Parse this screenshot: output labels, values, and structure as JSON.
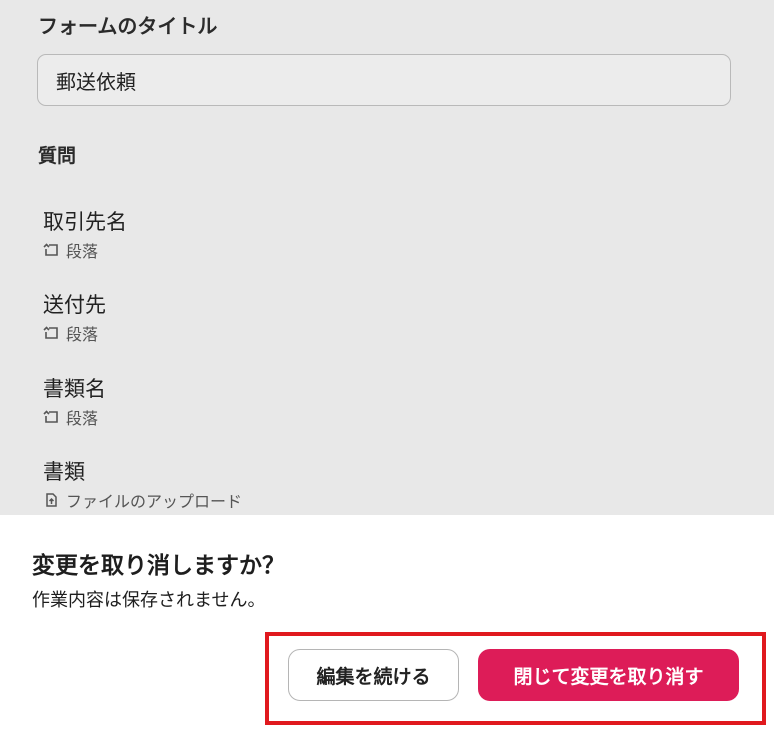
{
  "form": {
    "title_label": "フォームのタイトル",
    "title_value": "郵送依頼",
    "questions_label": "質問",
    "questions": [
      {
        "name": "取引先名",
        "type": "段落",
        "icon": "paragraph-icon"
      },
      {
        "name": "送付先",
        "type": "段落",
        "icon": "paragraph-icon"
      },
      {
        "name": "書類名",
        "type": "段落",
        "icon": "paragraph-icon"
      },
      {
        "name": "書類",
        "type": "ファイルのアップロード",
        "icon": "file-upload-icon"
      }
    ]
  },
  "dialog": {
    "title": "変更を取り消しますか？",
    "message": "作業内容は保存されません。",
    "continue_label": "編集を続ける",
    "discard_label": "閉じて変更を取り消す"
  },
  "colors": {
    "background": "#e8e8e8",
    "primary_button": "#dd1c58",
    "highlight_border": "#e0191e"
  }
}
